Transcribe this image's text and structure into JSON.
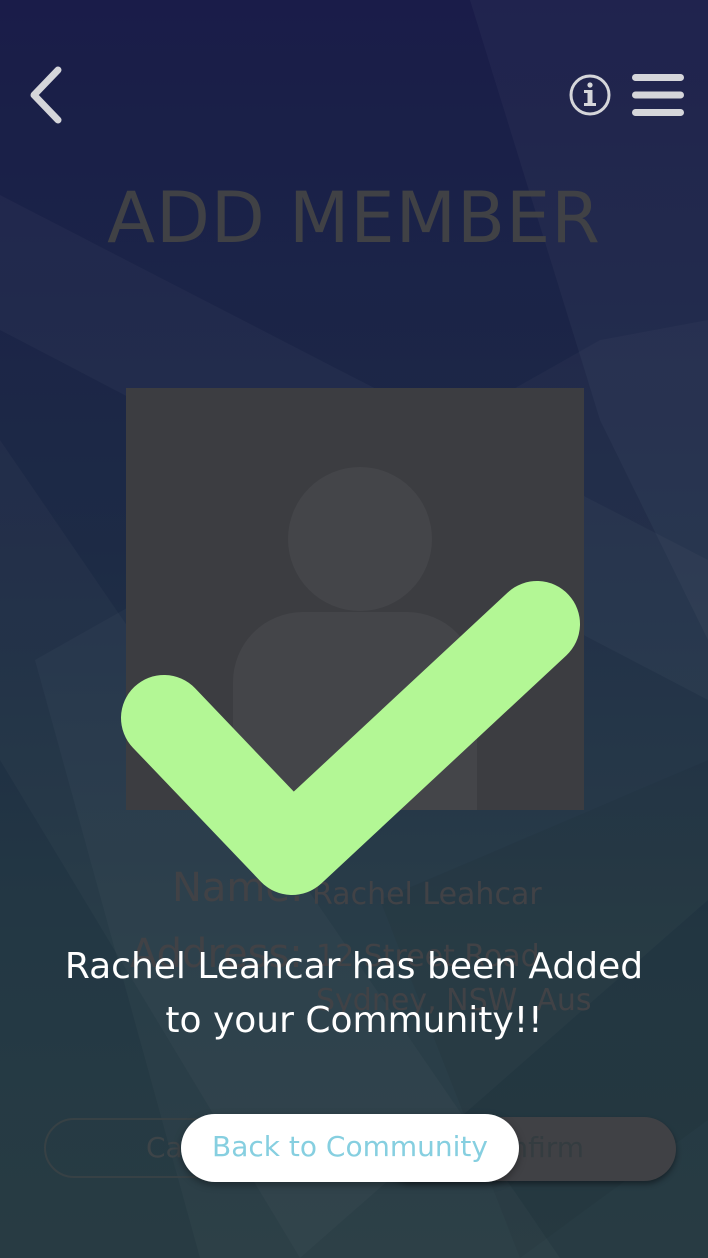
{
  "header": {
    "back_icon": "chevron-left-icon",
    "info_icon": "info-icon",
    "menu_icon": "hamburger-menu-icon"
  },
  "page": {
    "title": "ADD MEMBER"
  },
  "member": {
    "avatar_icon": "user-placeholder-icon",
    "name_label": "Name:",
    "name_value": "Rachel Leahcar",
    "address_label": "Address:",
    "address_line1": "12 Street Road",
    "address_line2": "Sydney, NSW, Aus"
  },
  "actions": {
    "cancel_label": "Cancel",
    "confirm_label": "Confirm"
  },
  "overlay": {
    "icon": "checkmark-icon",
    "message_line1": "Rachel Leahcar has been Added",
    "message_line2": "to your Community!!",
    "back_button_label": "Back to Community"
  },
  "colors": {
    "check_green": "#b3f795",
    "button_text": "#86cfe0"
  }
}
